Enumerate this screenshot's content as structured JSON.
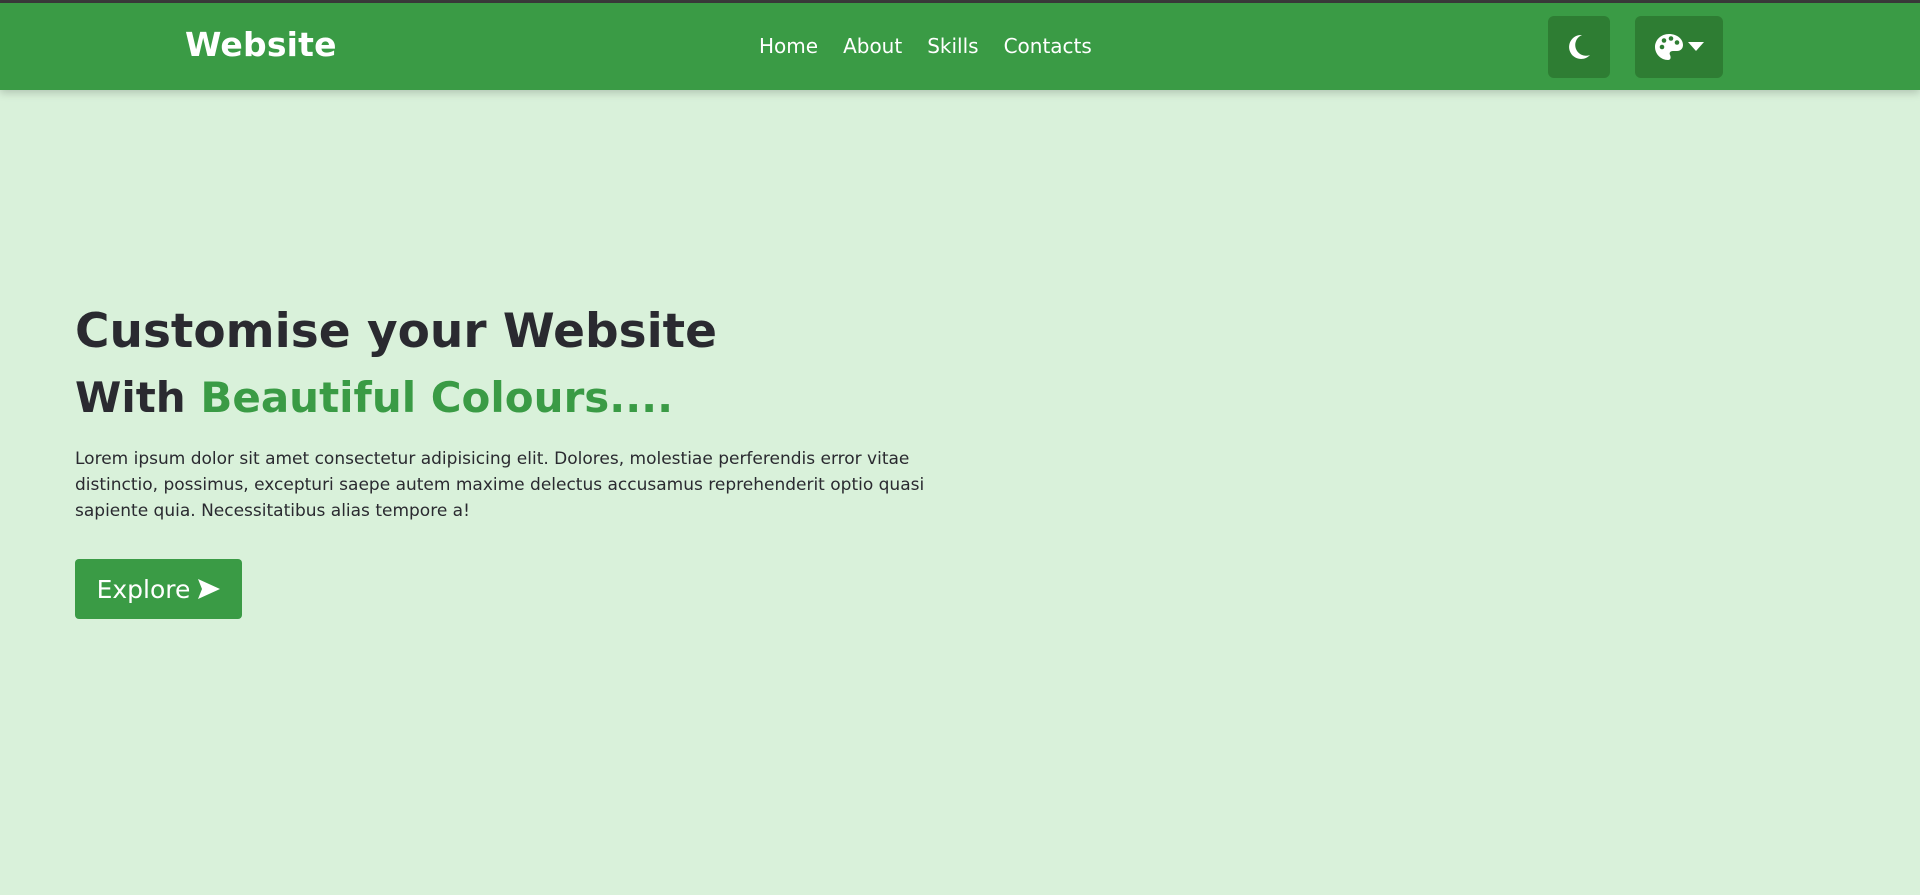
{
  "navbar": {
    "logo": "Website",
    "links": [
      "Home",
      "About",
      "Skills",
      "Contacts"
    ],
    "theme_toggle_icon": "moon-icon",
    "palette_icon": "palette-icon",
    "dropdown_icon": "caret-down-icon"
  },
  "hero": {
    "title": "Customise your Website",
    "subtitle_prefix": "With ",
    "subtitle_accent": "Beautiful Colours....",
    "text": "Lorem ipsum dolor sit amet consectetur adipisicing elit. Dolores, molestiae perferendis error vitae distinctio, possimus, excepturi saepe autem maxime delectus accusamus reprehenderit optio quasi sapiente quia. Necessitatibus alias tempore a!",
    "button_label": "Explore",
    "button_icon": "paper-plane-icon"
  },
  "colors": {
    "primary": "#3a9b45",
    "primary_dark": "#2e7d33",
    "background": "#d9f1da",
    "text": "#2a2a30"
  }
}
